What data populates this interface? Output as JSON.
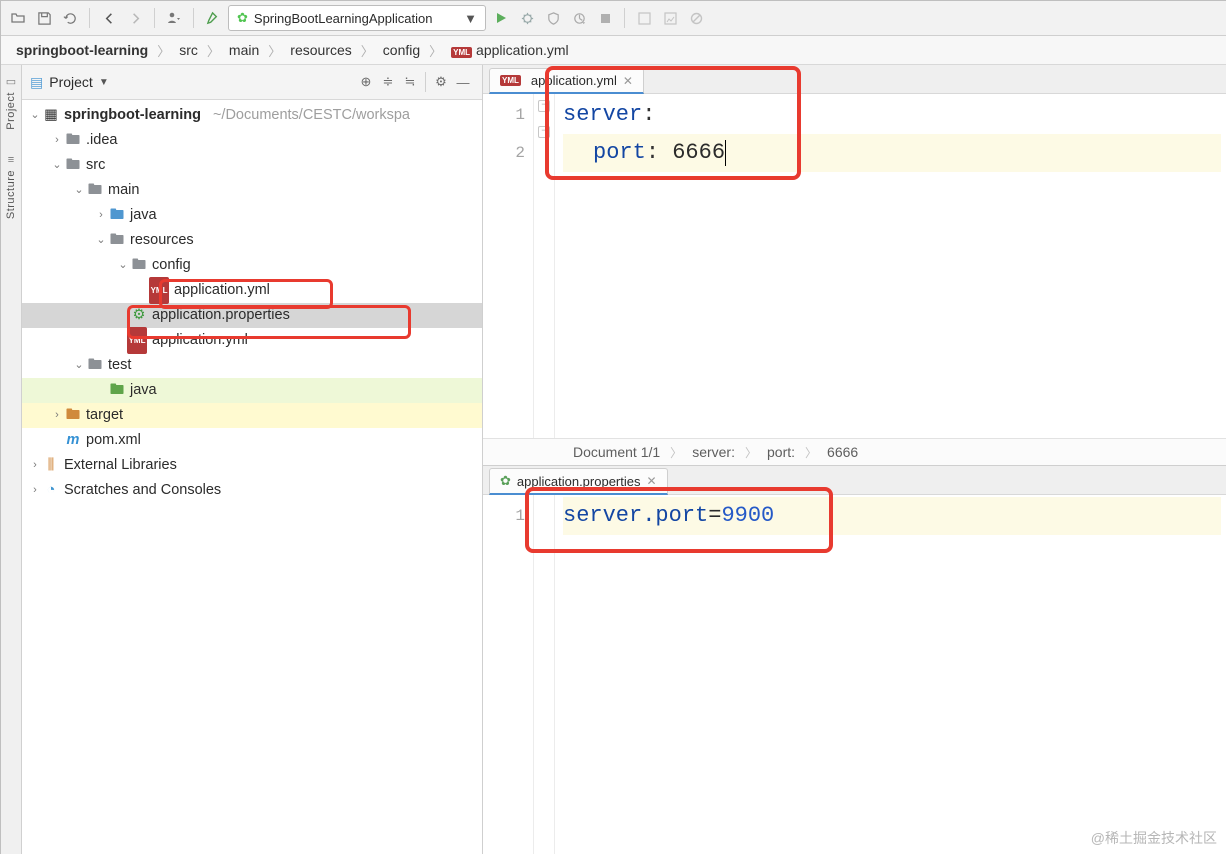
{
  "toolbar": {
    "run_config": "SpringBootLearningApplication"
  },
  "breadcrumb": {
    "items": [
      "springboot-learning",
      "src",
      "main",
      "resources",
      "config",
      "application.yml"
    ]
  },
  "sidebar_rail": {
    "project": "Project",
    "structure": "Structure"
  },
  "project_panel": {
    "title": "Project",
    "tree": {
      "root": "springboot-learning",
      "root_path": "~/Documents/CESTC/workspa",
      "idea": ".idea",
      "src": "src",
      "main": "main",
      "java_main": "java",
      "resources": "resources",
      "config": "config",
      "config_app_yml": "application.yml",
      "app_props": "application.properties",
      "res_app_yml": "application.yml",
      "test": "test",
      "java_test": "java",
      "target": "target",
      "pom": "pom.xml",
      "ext_lib": "External Libraries",
      "scratches": "Scratches and Consoles"
    }
  },
  "editor_top": {
    "tab": "application.yml",
    "lines": {
      "1": "1",
      "2": "2"
    },
    "code": {
      "server_key": "server",
      "port_key": "port",
      "port_val": "6666"
    },
    "status": {
      "doc": "Document 1/1",
      "p1": "server:",
      "p2": "port:",
      "val": "6666"
    }
  },
  "editor_bottom": {
    "tab": "application.properties",
    "lines": {
      "1": "1"
    },
    "code": {
      "key": "server.port",
      "eq": "=",
      "val": "9900"
    }
  },
  "watermark": "@稀土掘金技术社区"
}
